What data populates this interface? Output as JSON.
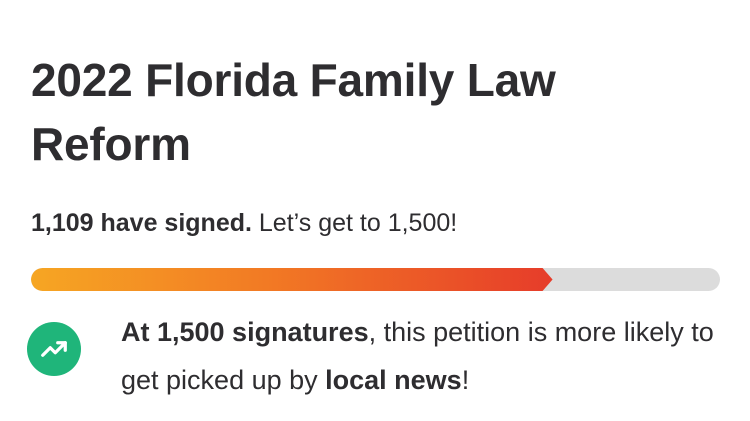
{
  "petition": {
    "title": "2022 Florida Family Law Reform"
  },
  "progress": {
    "signed_count": "1,109 have signed.",
    "goal_text": "Let’s get to 1,500!",
    "signed": 1109,
    "goal": 1500,
    "fill_fraction": 0.757,
    "track_color": "#dcdcdc",
    "fill_colors": [
      "#f6a623",
      "#f27a24",
      "#e63c2a"
    ]
  },
  "milestone": {
    "icon": "trending-up-icon",
    "icon_color": "#1fb57a",
    "bold_lead": "At 1,500 signatures",
    "middle": ", this petition is more likely to get picked up by ",
    "bold_tail": "local news",
    "end": "!"
  }
}
